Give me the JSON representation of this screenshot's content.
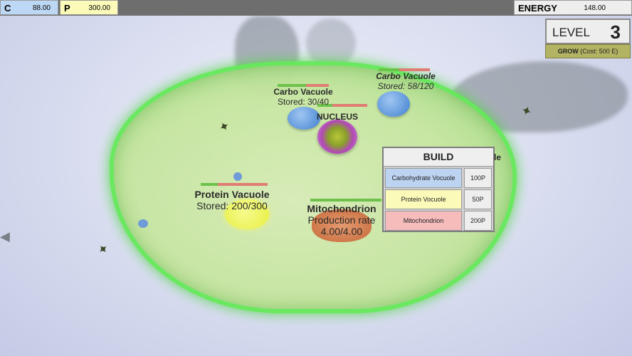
{
  "resources": {
    "carbs": {
      "key": "C",
      "value": "88.00"
    },
    "protein": {
      "key": "P",
      "value": "300.00"
    },
    "energy": {
      "key": "ENERGY",
      "value": "148.00"
    }
  },
  "level": {
    "label": "LEVEL",
    "number": "3"
  },
  "grow": {
    "label": "GROW",
    "cost": "(Cost: 500 E)"
  },
  "build": {
    "title": "BUILD",
    "items": [
      {
        "name": "Carbohydrate Vocuole",
        "cost": "100P"
      },
      {
        "name": "Protein Vocuole",
        "cost": "50P"
      },
      {
        "name": "Mitochondrion",
        "cost": "200P"
      }
    ]
  },
  "organelles": {
    "carbo1": {
      "title": "Carbo Vacuole",
      "status": "Stored: 30/40",
      "health": 0.55
    },
    "carbo2": {
      "title": "Carbo Vacuole",
      "status": "Stored: 58/120",
      "health": 0.4
    },
    "nucleus": {
      "title": "NUCLEUS",
      "health": 0.3
    },
    "protein": {
      "title": "Protein Vacuole",
      "status": "Stored: 200/300",
      "health": 0.25
    },
    "mito": {
      "title": "Mitochondrion",
      "status": "Production rate",
      "rate": "4.00/4.00",
      "health": 1.0
    }
  },
  "peek_text": "le",
  "colors": {
    "cell_membrane": "#66e95a",
    "carbs": "#bcd8f5",
    "protein": "#fbfab9",
    "mito_button": "#f6bcbc",
    "grow_button": "#b3b463"
  }
}
